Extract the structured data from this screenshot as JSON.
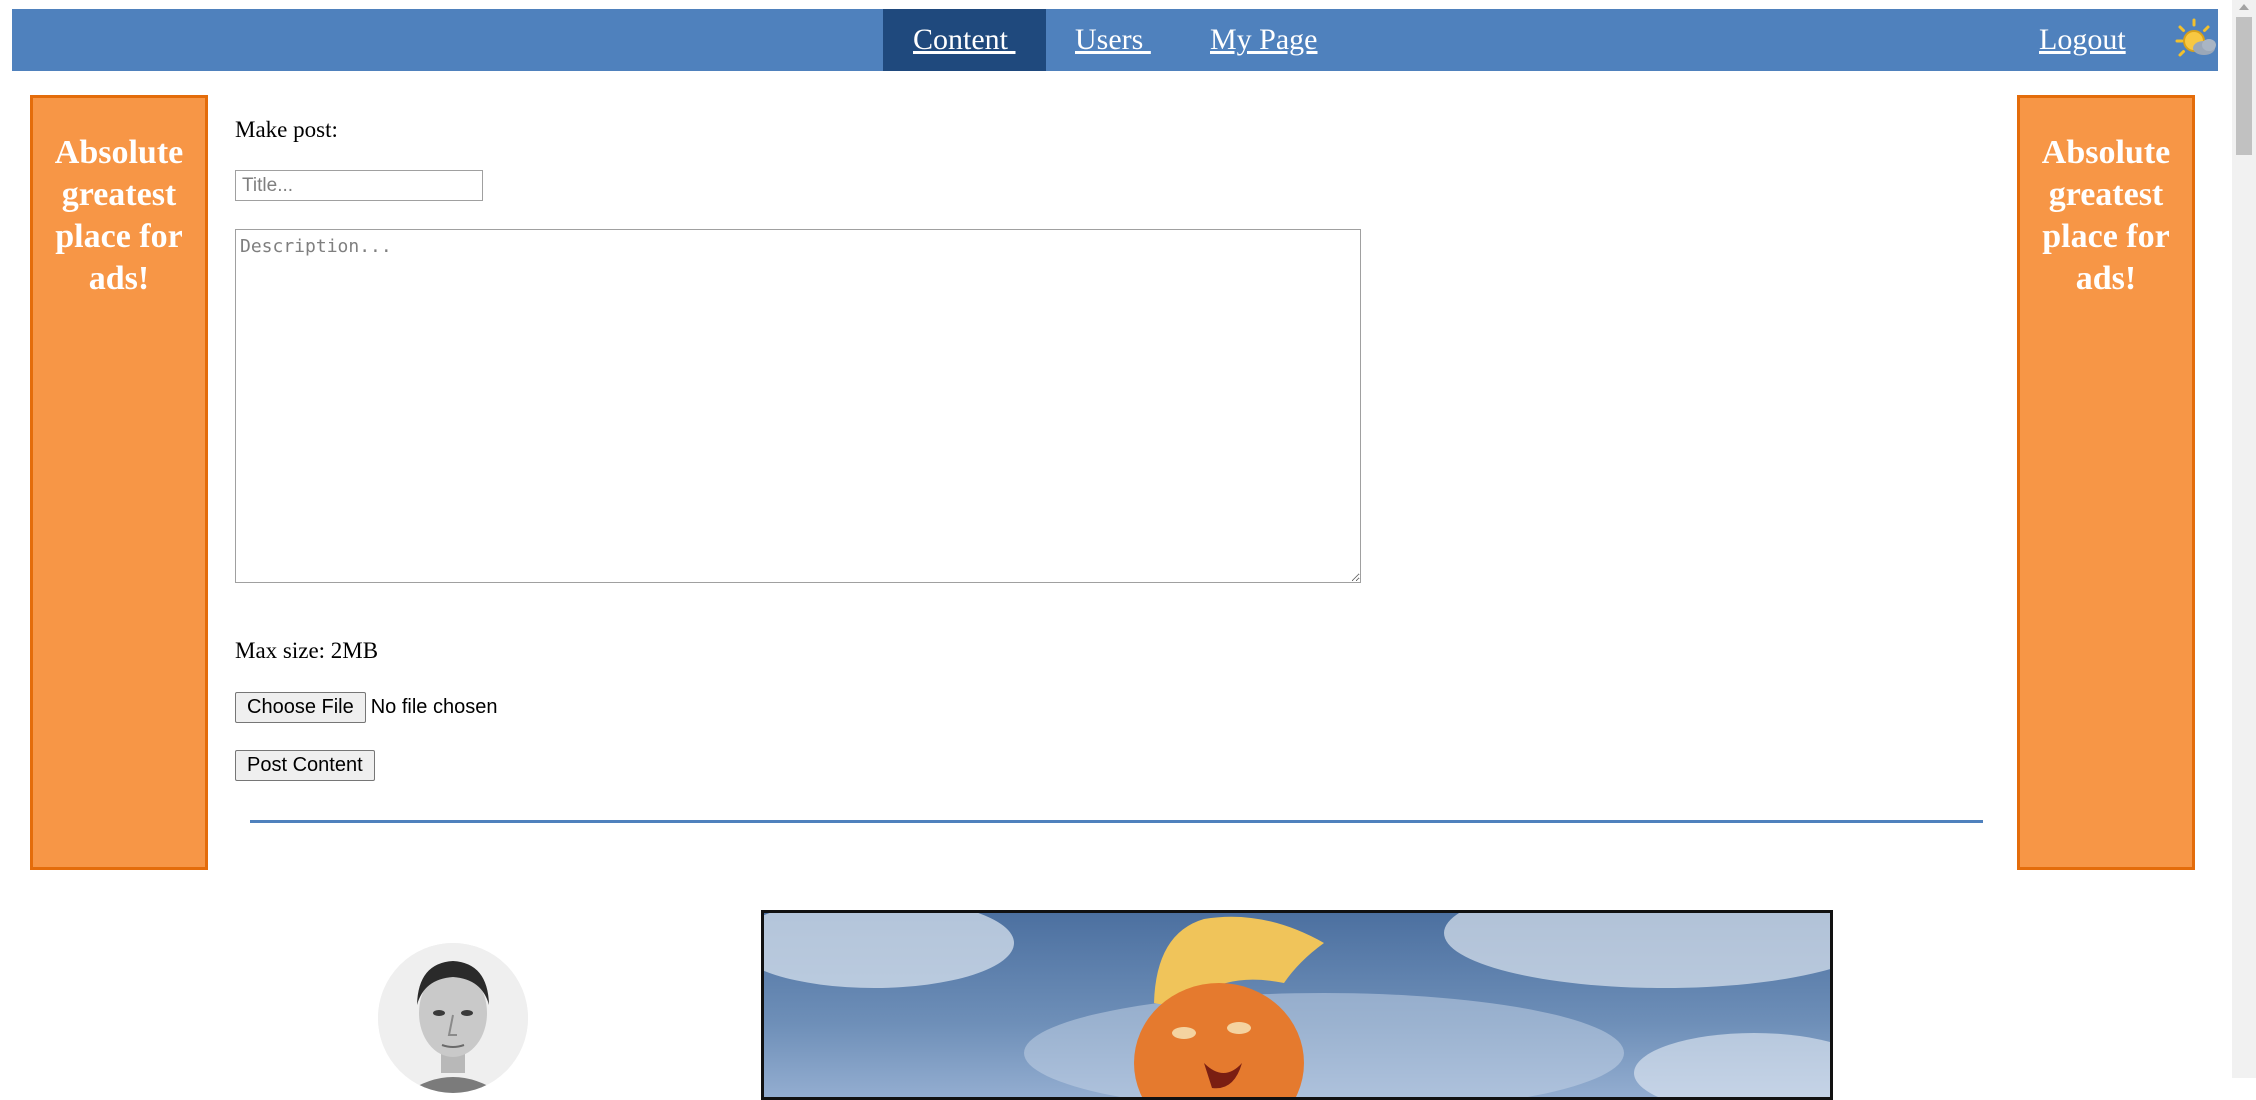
{
  "nav": {
    "tabs": [
      {
        "label": "Content ",
        "active": true
      },
      {
        "label": "Users ",
        "active": false
      },
      {
        "label": "My Page",
        "active": false
      }
    ],
    "logout": "Logout",
    "icon": "weather-sun-cloud-icon"
  },
  "ads": {
    "left": "Absolute greatest place for ads!",
    "right": "Absolute greatest place for ads!"
  },
  "form": {
    "heading": "Make post:",
    "title_placeholder": "Title...",
    "description_placeholder": "Description...",
    "max_size": "Max size: 2MB",
    "choose_file": "Choose File",
    "file_status": "No file chosen",
    "submit": "Post Content"
  },
  "colors": {
    "nav_bg": "#4f81bd",
    "nav_active": "#1f497d",
    "ad_bg": "#f79646",
    "ad_border": "#e46c0a"
  }
}
